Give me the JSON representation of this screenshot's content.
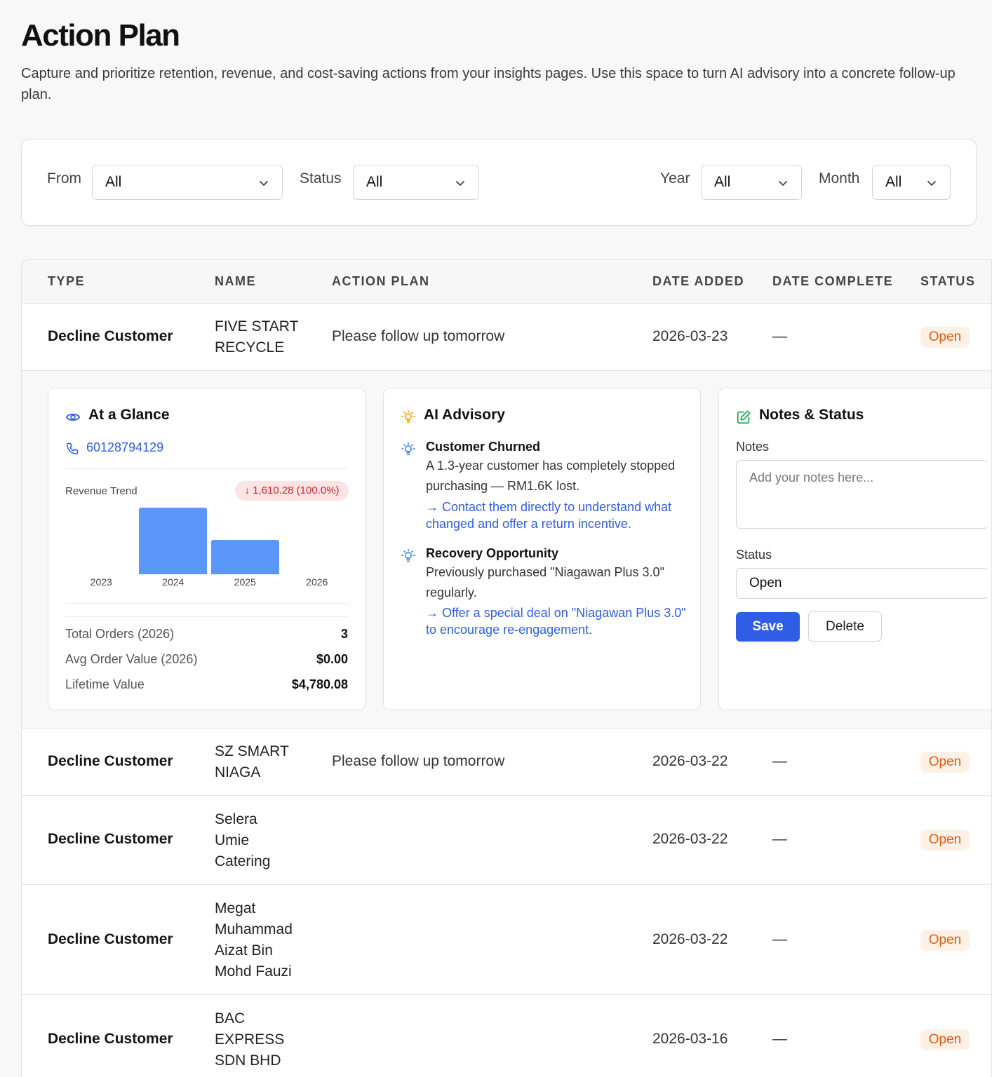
{
  "page": {
    "title": "Action Plan",
    "description": "Capture and prioritize retention, revenue, and cost-saving actions from your insights pages. Use this space to turn AI advisory into a concrete follow-up plan."
  },
  "filters": {
    "from": {
      "label": "From",
      "value": "All"
    },
    "status": {
      "label": "Status",
      "value": "All"
    },
    "year": {
      "label": "Year",
      "value": "All"
    },
    "month": {
      "label": "Month",
      "value": "All"
    }
  },
  "table": {
    "headers": [
      "TYPE",
      "NAME",
      "ACTION PLAN",
      "DATE ADDED",
      "DATE COMPLETE",
      "STATUS"
    ],
    "rows": [
      {
        "type": "Decline Customer",
        "name": "FIVE START\nRECYCLE",
        "plan": "Please follow up tomorrow",
        "date_added": "2026-03-23",
        "date_complete": "—",
        "status": "Open"
      },
      {
        "type": "Decline Customer",
        "name": "SZ SMART\nNIAGA",
        "plan": "Please follow up tomorrow",
        "date_added": "2026-03-22",
        "date_complete": "—",
        "status": "Open"
      },
      {
        "type": "Decline Customer",
        "name": "Selera\nUmie\nCatering",
        "plan": "",
        "date_added": "2026-03-22",
        "date_complete": "—",
        "status": "Open"
      },
      {
        "type": "Decline Customer",
        "name": "Megat\nMuhammad\nAizat Bin\nMohd Fauzi",
        "plan": "",
        "date_added": "2026-03-22",
        "date_complete": "—",
        "status": "Open"
      },
      {
        "type": "Decline Customer",
        "name": "BAC\nEXPRESS\nSDN BHD",
        "plan": "",
        "date_added": "2026-03-16",
        "date_complete": "—",
        "status": "Open"
      }
    ]
  },
  "glance": {
    "title": "At a Glance",
    "phone": "60128794129",
    "revenue_label": "Revenue Trend",
    "revenue_change": "↓ 1,610.28 (100.0%)",
    "stats": [
      {
        "label": "Total Orders (2026)",
        "value": "3"
      },
      {
        "label": "Avg Order Value (2026)",
        "value": "$0.00"
      },
      {
        "label": "Lifetime Value",
        "value": "$4,780.08"
      }
    ]
  },
  "chart_data": {
    "type": "bar",
    "categories": [
      "2023",
      "2024",
      "2025",
      "2026"
    ],
    "values": [
      0,
      1610.28,
      830,
      0
    ],
    "title": "Revenue Trend",
    "ylim": [
      0,
      1610.28
    ]
  },
  "advisory": {
    "title": "AI Advisory",
    "items": [
      {
        "title": "Customer Churned",
        "text": "A 1.3-year customer has completely stopped purchasing — RM1.6K lost.",
        "action": "→ Contact them directly to understand what changed and offer a return incentive."
      },
      {
        "title": "Recovery Opportunity",
        "text": "Previously purchased \"Niagawan Plus 3.0\" regularly.",
        "action": "→ Offer a special deal on \"Niagawan Plus 3.0\" to encourage re-engagement."
      }
    ]
  },
  "notes": {
    "title": "Notes & Status",
    "notes_label": "Notes",
    "notes_placeholder": "Add your notes here...",
    "status_label": "Status",
    "status_value": "Open",
    "save_label": "Save",
    "delete_label": "Delete"
  },
  "colors": {
    "accent": "#2f5de6",
    "bar": "#5b96fb",
    "open_badge": "#e25a0e",
    "decline_badge": "#c92a2a"
  }
}
